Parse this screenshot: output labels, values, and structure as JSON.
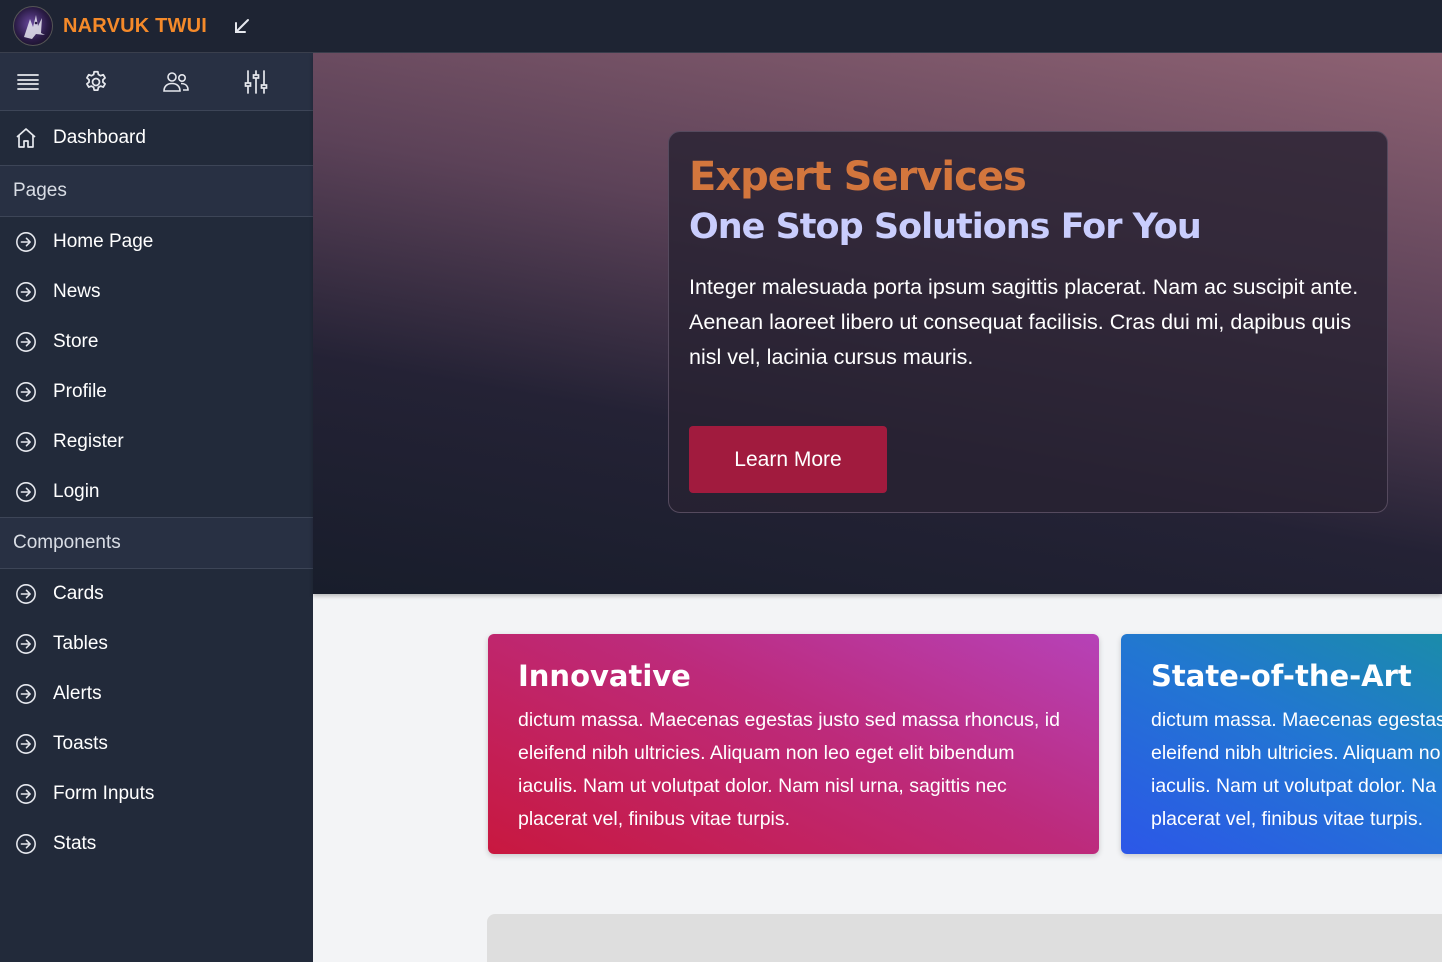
{
  "app": {
    "brand_name": "NARVUK TWUI",
    "brand_color": "#f58a2a"
  },
  "topbar": {
    "collapse_icon": "arrow-down-left-icon"
  },
  "sidebar": {
    "tools": [
      {
        "name": "menu-icon"
      },
      {
        "name": "gear-icon"
      },
      {
        "name": "users-icon"
      },
      {
        "name": "sliders-icon"
      }
    ],
    "dashboard_label": "Dashboard",
    "pages_heading": "Pages",
    "pages": [
      {
        "label": "Home Page"
      },
      {
        "label": "News"
      },
      {
        "label": "Store"
      },
      {
        "label": "Profile"
      },
      {
        "label": "Register"
      },
      {
        "label": "Login"
      }
    ],
    "components_heading": "Components",
    "components": [
      {
        "label": "Cards"
      },
      {
        "label": "Tables"
      },
      {
        "label": "Alerts"
      },
      {
        "label": "Toasts"
      },
      {
        "label": "Form Inputs"
      },
      {
        "label": "Stats"
      }
    ]
  },
  "hero": {
    "title": "Expert Services",
    "subtitle": "One Stop Solutions For You",
    "text": "Integer malesuada porta ipsum sagittis placerat. Nam ac suscipit ante. Aenean laoreet libero ut consequat facilisis. Cras dui mi, dapibus quis nisl vel, lacinia cursus mauris.",
    "button_label": "Learn More",
    "title_color": "#d3763d",
    "subtitle_color": "#c9cdfd",
    "button_color": "#a11b3e"
  },
  "features": [
    {
      "title": "Innovative",
      "lines": [
        "dictum massa. Maecenas egestas justo sed massa rhoncus, id",
        "eleifend nibh ultricies. Aliquam non leo eget elit bibendum",
        "iaculis. Nam ut volutpat dolor. Nam nisl urna, sagittis nec",
        "placerat vel, finibus vitae turpis."
      ]
    },
    {
      "title": "State-of-the-Art",
      "lines": [
        "dictum massa. Maecenas egestas",
        "eleifend nibh ultricies. Aliquam no",
        "iaculis. Nam ut volutpat dolor. Na",
        "placerat vel, finibus vitae turpis."
      ]
    }
  ]
}
